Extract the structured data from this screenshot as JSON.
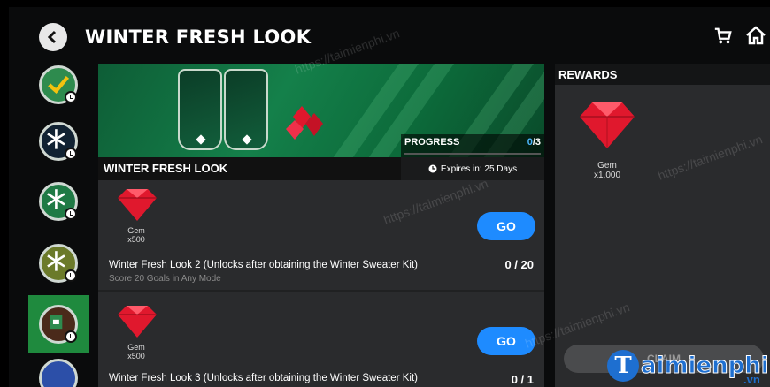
{
  "header": {
    "title": "WINTER FRESH LOOK"
  },
  "sidebar": {
    "items": [
      {
        "name": "completed",
        "color": "#2e8b4e"
      },
      {
        "name": "snowflake",
        "color": "#1f7a45"
      },
      {
        "name": "snowflake",
        "color": "#1f7a45"
      },
      {
        "name": "snowflake",
        "color": "#1f7a45"
      },
      {
        "name": "winter-kit",
        "color": "#1f8a3e",
        "active": true
      },
      {
        "name": "next",
        "color": "#2c4fa8"
      }
    ]
  },
  "banner": {
    "name": "WINTER FRESH LOOK",
    "progress_label": "PROGRESS",
    "progress_current": "0",
    "progress_total": "/3",
    "progress_fraction": 0,
    "expires": "Expires in: 25 Days"
  },
  "objectives": [
    {
      "reward_name": "Gem",
      "reward_qty": "x500",
      "go_label": "GO",
      "title": "Winter Fresh Look 2 (Unlocks after obtaining the Winter Sweater Kit)",
      "count": "0 / 20",
      "desc": "Score 20 Goals in Any Mode"
    },
    {
      "reward_name": "Gem",
      "reward_qty": "x500",
      "go_label": "GO",
      "title": "Winter Fresh Look 3 (Unlocks after obtaining the Winter Sweater Kit)",
      "count": "0 / 1",
      "desc": ""
    }
  ],
  "rewards": {
    "title": "REWARDS",
    "reward_name": "Gem",
    "reward_qty": "x1,000",
    "claim_label": "CLAIM"
  },
  "watermark": {
    "text": "https://taimienphi.vn",
    "logo_letter": "T",
    "logo_text": "aimienphi",
    "logo_suffix": ".vn"
  },
  "colors": {
    "accent_blue": "#1e8bff",
    "gem_red": "#e0182d",
    "active_green": "#1f8a3e"
  }
}
